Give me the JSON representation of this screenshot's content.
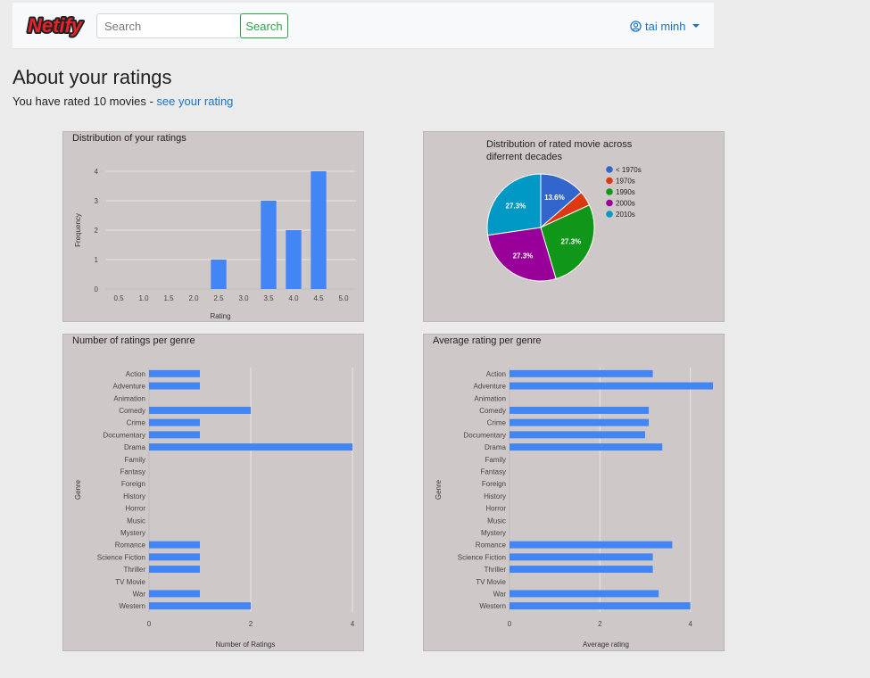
{
  "app": {
    "logo_text": "Netify",
    "search_placeholder": "Search",
    "search_button": "Search",
    "user_name": "tai minh",
    "user_icon": "user-circle-icon"
  },
  "page": {
    "title": "About your ratings",
    "rated_prefix": "You have rated 10 movies - ",
    "rated_link": "see your rating"
  },
  "colors": {
    "bar": "#4285f4",
    "panel": "#cfc8c8",
    "grid": "#e8e4e4",
    "link": "#1a73c8",
    "search_button": "#28a745"
  },
  "chart_data": [
    {
      "type": "bar",
      "title": "Distribution of your ratings",
      "xlabel": "Rating",
      "ylabel": "Frequency",
      "categories": [
        "0.5",
        "1.0",
        "1.5",
        "2.0",
        "2.5",
        "3.0",
        "3.5",
        "4.0",
        "4.5",
        "5.0"
      ],
      "values": [
        0,
        0,
        0,
        0,
        1,
        0,
        3,
        2,
        4,
        0
      ],
      "ylim": [
        0,
        4
      ],
      "yticks": [
        "0",
        "1",
        "2",
        "3",
        "4"
      ],
      "grid": true
    },
    {
      "type": "pie",
      "title_lines": [
        "Distribution of rated movie across",
        "diferrent decades"
      ],
      "legend_position": "right",
      "slices": [
        {
          "label": "< 1970s",
          "value": 13.6,
          "pct_label": "13.6%",
          "color": "#3366cc"
        },
        {
          "label": "1970s",
          "value": 4.5,
          "pct_label": "",
          "color": "#dc3912"
        },
        {
          "label": "1990s",
          "value": 27.3,
          "pct_label": "27.3%",
          "color": "#109618"
        },
        {
          "label": "2000s",
          "value": 27.3,
          "pct_label": "27.3%",
          "color": "#990099"
        },
        {
          "label": "2010s",
          "value": 27.3,
          "pct_label": "27.3%",
          "color": "#0099c6"
        }
      ]
    },
    {
      "type": "bar",
      "orientation": "horizontal",
      "title": "Number of ratings per genre",
      "xlabel": "Number of Ratings",
      "ylabel": "Genre",
      "categories": [
        "Action",
        "Adventure",
        "Animation",
        "Comedy",
        "Crime",
        "Documentary",
        "Drama",
        "Family",
        "Fantasy",
        "Foreign",
        "History",
        "Horror",
        "Music",
        "Mystery",
        "Romance",
        "Science Fiction",
        "Thriller",
        "TV Movie",
        "War",
        "Western"
      ],
      "values": [
        1,
        1,
        0,
        2,
        1,
        1,
        4,
        0,
        0,
        0,
        0,
        0,
        0,
        0,
        1,
        1,
        1,
        0,
        1,
        2
      ],
      "xlim": [
        0,
        4
      ],
      "xticks": [
        "0",
        "2",
        "4"
      ],
      "grid": true
    },
    {
      "type": "bar",
      "orientation": "horizontal",
      "title": "Average rating per genre",
      "xlabel": "Average rating",
      "ylabel": "Genre",
      "categories": [
        "Action",
        "Adventure",
        "Animation",
        "Comedy",
        "Crime",
        "Documentary",
        "Drama",
        "Family",
        "Fantasy",
        "Foreign",
        "History",
        "Horror",
        "Music",
        "Mystery",
        "Romance",
        "Science Fiction",
        "Thriller",
        "TV Movie",
        "War",
        "Western"
      ],
      "values": [
        3.17,
        4.5,
        0,
        3.08,
        3.08,
        3.0,
        3.38,
        0,
        0,
        0,
        0,
        0,
        0,
        0,
        3.6,
        3.17,
        3.17,
        0,
        3.3,
        4.0
      ],
      "xlim": [
        0,
        4.5
      ],
      "xticks": [
        "0",
        "2",
        "4"
      ],
      "grid": true
    }
  ]
}
